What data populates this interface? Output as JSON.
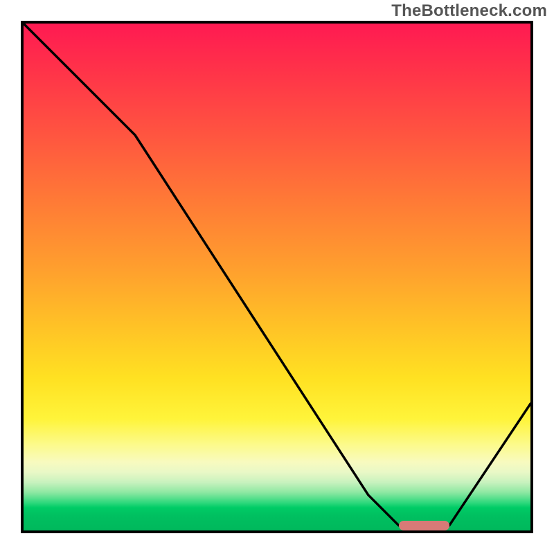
{
  "watermark": "TheBottleneck.com",
  "chart_data": {
    "type": "line",
    "title": "",
    "xlabel": "",
    "ylabel": "",
    "xlim": [
      0,
      100
    ],
    "ylim": [
      0,
      100
    ],
    "grid": false,
    "legend": false,
    "background": "vertical-gradient red→orange→yellow→green",
    "series": [
      {
        "name": "bottleneck-curve",
        "x": [
          0,
          22,
          68,
          74,
          84,
          100
        ],
        "values": [
          100,
          78,
          7,
          1,
          1,
          25
        ],
        "note": "valley minimum ≈1 around x=74–84, left shoulder kink near x≈22"
      }
    ],
    "marker": {
      "name": "optimal-range",
      "x_start": 74,
      "x_end": 84,
      "y": 1,
      "color": "#d87a77"
    }
  }
}
